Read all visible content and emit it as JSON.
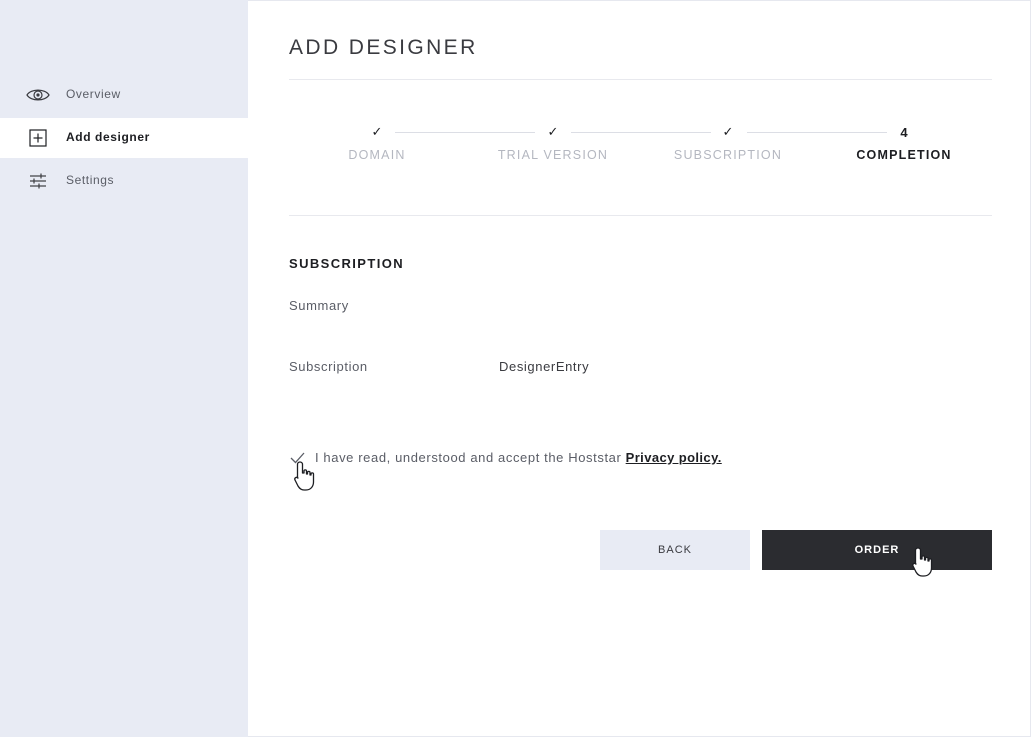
{
  "sidebar": {
    "items": [
      {
        "label": "Overview",
        "icon": "eye-icon",
        "active": false
      },
      {
        "label": "Add designer",
        "icon": "plus-square-icon",
        "active": true
      },
      {
        "label": "Settings",
        "icon": "sliders-icon",
        "active": false
      }
    ]
  },
  "main": {
    "title": "ADD DESIGNER",
    "stepper": {
      "steps": [
        {
          "mark": "✓",
          "name": "DOMAIN",
          "state": "done"
        },
        {
          "mark": "✓",
          "name": "TRIAL VERSION",
          "state": "done"
        },
        {
          "mark": "✓",
          "name": "SUBSCRIPTION",
          "state": "done"
        },
        {
          "mark": "4",
          "name": "COMPLETION",
          "state": "current"
        }
      ]
    },
    "section_title": "SUBSCRIPTION",
    "summary_label": "Summary",
    "subscription": {
      "label": "Subscription",
      "value": "DesignerEntry"
    },
    "consent": {
      "checked": true,
      "text": "I have read, understood and accept the Hoststar ",
      "link": "Privacy policy."
    },
    "buttons": {
      "back": "BACK",
      "order": "ORDER"
    }
  },
  "colors": {
    "sidebar_bg": "#e8ebf4",
    "primary_button": "#2b2c30",
    "secondary_button": "#e8ebf4",
    "muted_text": "#b4b7c0"
  }
}
